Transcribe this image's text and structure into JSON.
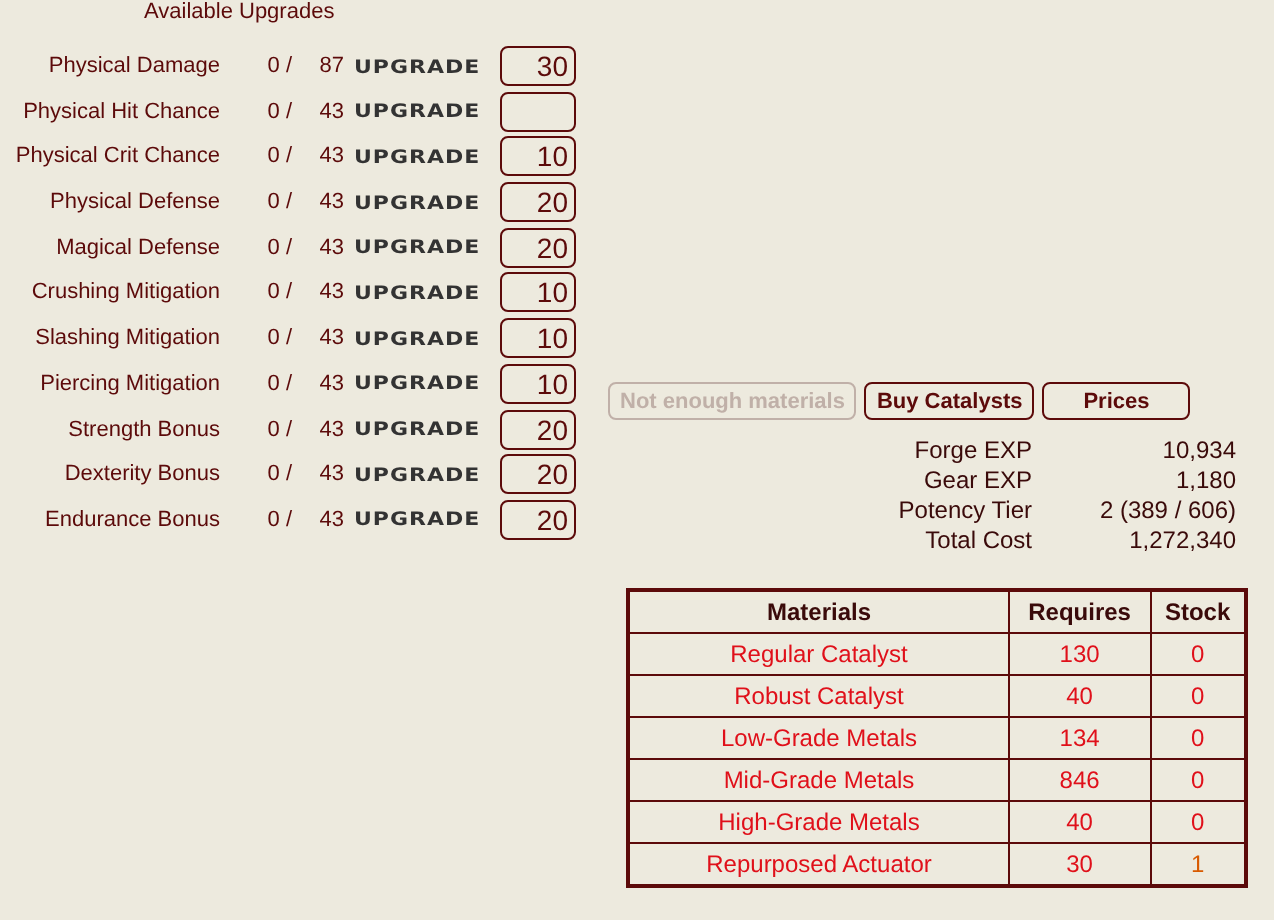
{
  "title": "Available Upgrades",
  "upgrades": [
    {
      "name": "Physical Damage",
      "current": "0 /",
      "max": "87",
      "button": "UPGRADE",
      "value": "30"
    },
    {
      "name": "Physical Hit Chance",
      "current": "0 /",
      "max": "43",
      "button": "UPGRADE"
    },
    {
      "name": "Physical Crit Chance",
      "current": "0 /",
      "max": "43",
      "button": "UPGRADE",
      "value": "10"
    },
    {
      "name": "Physical Defense",
      "current": "0 /",
      "max": "43",
      "button": "UPGRADE",
      "value": "20"
    },
    {
      "name": "Magical Defense",
      "current": "0 /",
      "max": "43",
      "button": "UPGRADE",
      "value": "20"
    },
    {
      "name": "Crushing Mitigation",
      "current": "0 /",
      "max": "43",
      "button": "UPGRADE",
      "value": "10"
    },
    {
      "name": "Slashing Mitigation",
      "current": "0 /",
      "max": "43",
      "button": "UPGRADE",
      "value": "10"
    },
    {
      "name": "Piercing Mitigation",
      "current": "0 /",
      "max": "43",
      "button": "UPGRADE",
      "value": "10"
    },
    {
      "name": "Strength Bonus",
      "current": "0 /",
      "max": "43",
      "button": "UPGRADE",
      "value": "20"
    },
    {
      "name": "Dexterity Bonus",
      "current": "0 /",
      "max": "43",
      "button": "UPGRADE",
      "value": "20"
    },
    {
      "name": "Endurance Bonus",
      "current": "0 /",
      "max": "43",
      "button": "UPGRADE",
      "value": "20"
    }
  ],
  "buttons": [
    {
      "label": "Not enough materials",
      "disabled": true
    },
    {
      "label": "Buy Catalysts",
      "disabled": false
    },
    {
      "label": "Prices",
      "disabled": false
    }
  ],
  "stats": [
    {
      "label": "Forge EXP",
      "value": "10,934"
    },
    {
      "label": "Gear EXP",
      "value": "1,180"
    },
    {
      "label": "Potency Tier",
      "value": "2 (389 / 606)"
    },
    {
      "label": "Total Cost",
      "value": "1,272,340"
    }
  ],
  "table": {
    "columns": [
      "Materials",
      "Requires",
      "Stock"
    ],
    "rows": [
      {
        "material": "Regular Catalyst",
        "requires": "130",
        "stock": "0",
        "color": "#e0101a"
      },
      {
        "material": "Robust Catalyst",
        "requires": "40",
        "stock": "0",
        "color": "#e0101a"
      },
      {
        "material": "Low-Grade Metals",
        "requires": "134",
        "stock": "0",
        "color": "#e0101a"
      },
      {
        "material": "Mid-Grade Metals",
        "requires": "846",
        "stock": "0",
        "color": "#e0101a"
      },
      {
        "material": "High-Grade Metals",
        "requires": "40",
        "stock": "0",
        "color": "#e0101a"
      },
      {
        "material": "Repurposed Actuator",
        "requires": "30",
        "stock": "1",
        "color": "#d85a00"
      }
    ]
  }
}
